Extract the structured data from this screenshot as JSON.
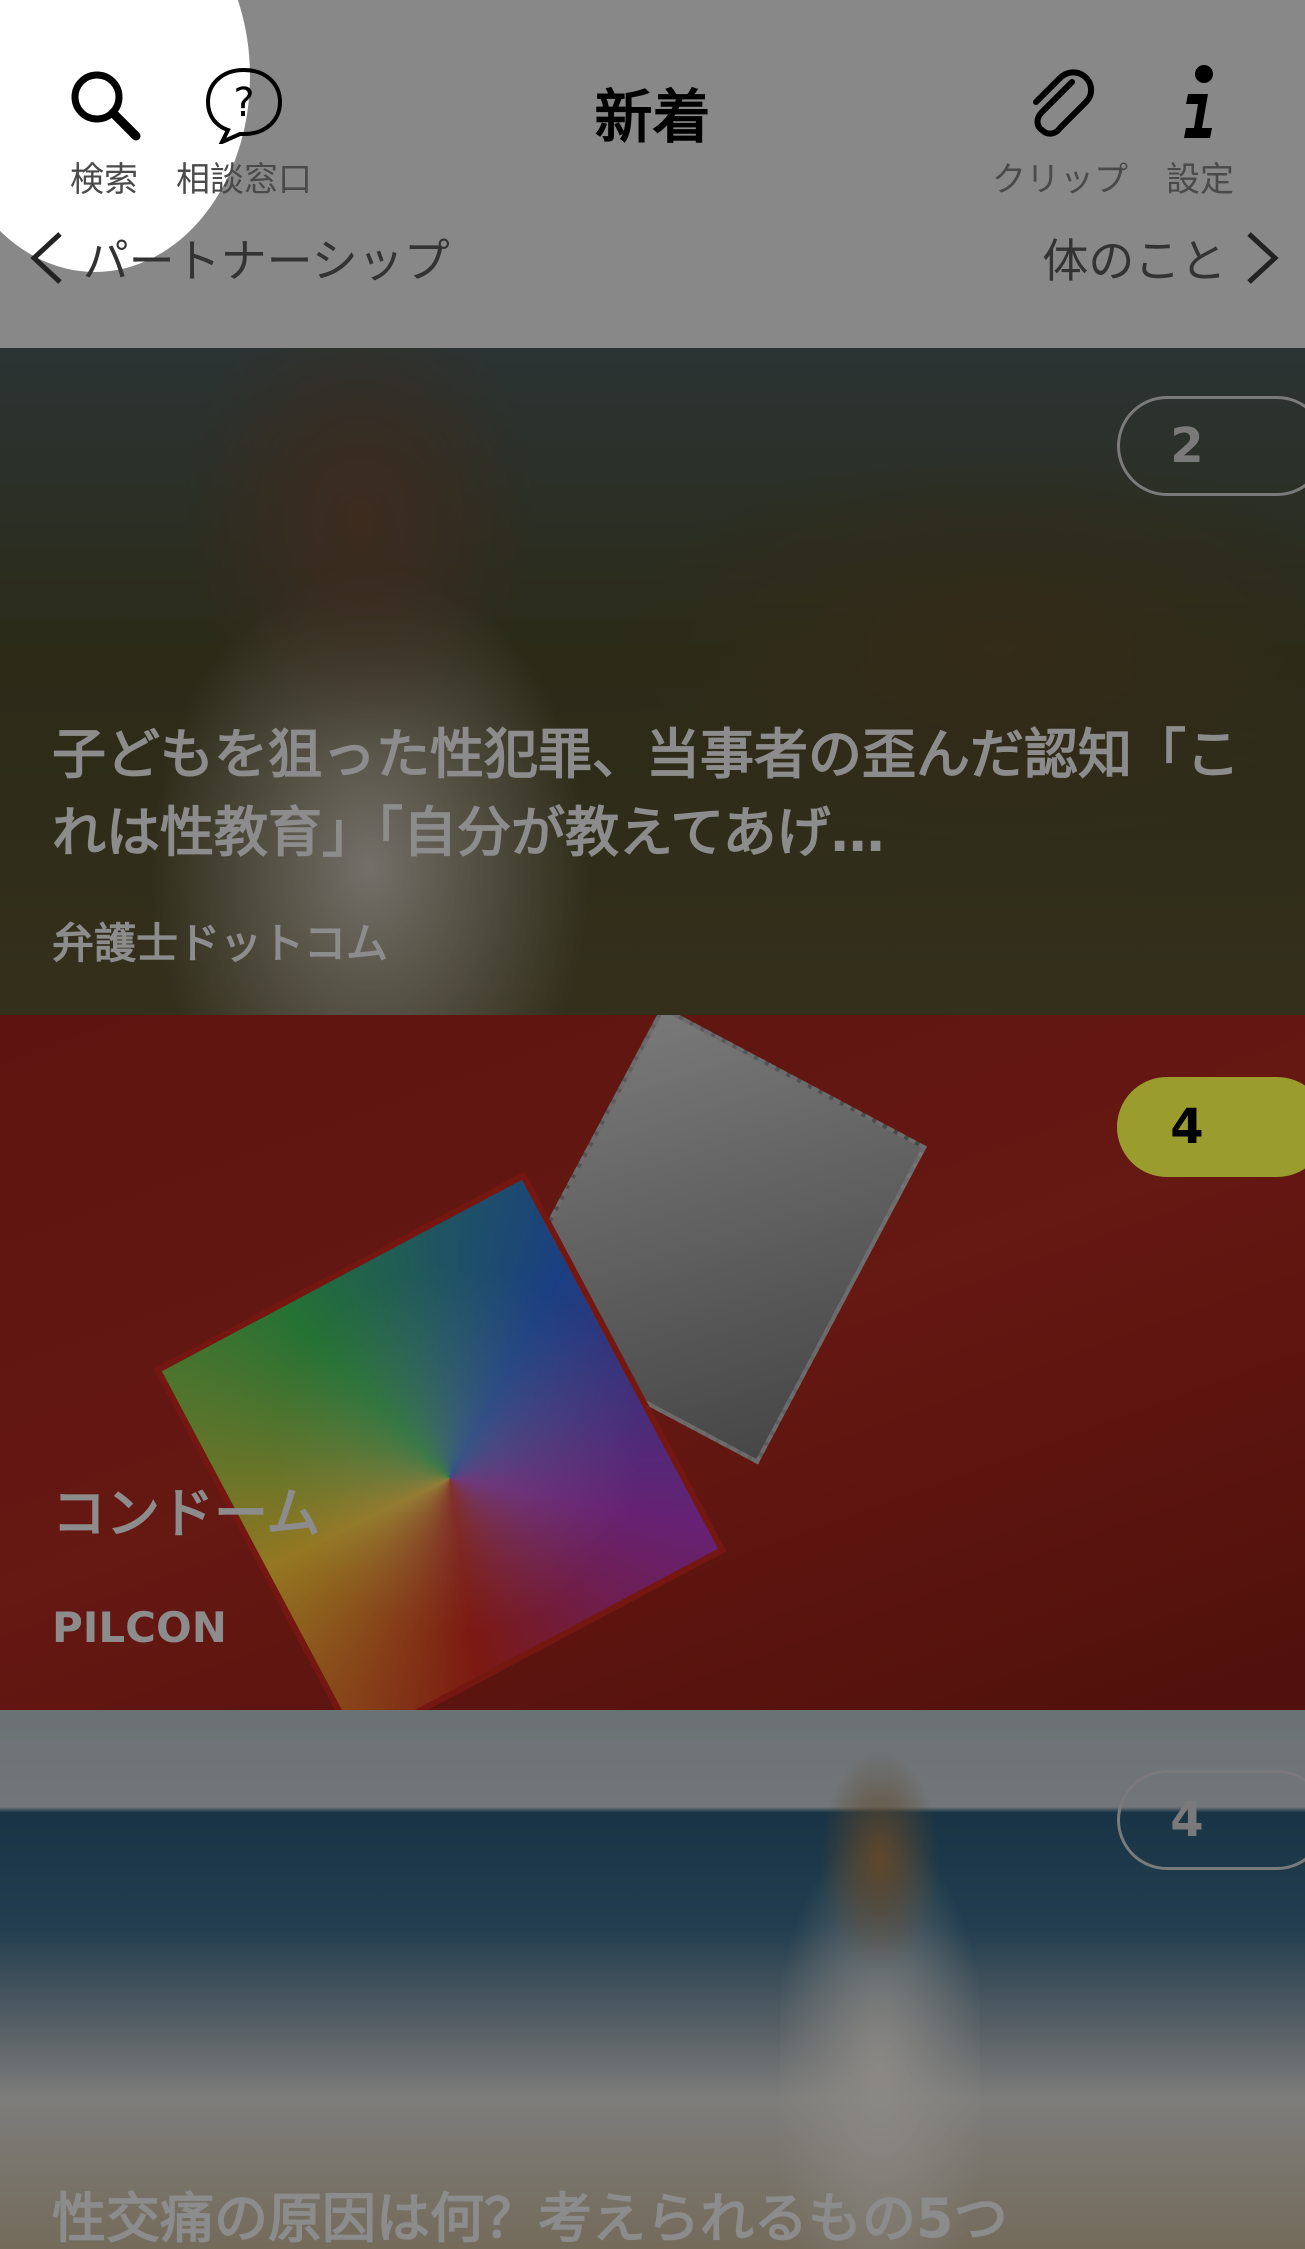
{
  "header": {
    "title": "新着",
    "search_label": "検索",
    "consult_label": "相談窓口",
    "clip_label": "クリップ",
    "settings_label": "設定",
    "prev_category": "パートナーシップ",
    "next_category": "体のこと"
  },
  "articles": [
    {
      "headline": "子どもを狙った性犯罪、当事者の歪んだ認知「これは性教育」「自分が教えてあげ…",
      "source": "弁護士ドットコム",
      "badge": "2"
    },
    {
      "headline": "コンドーム",
      "source": "PILCON",
      "badge": "4"
    },
    {
      "headline": "性交痛の原因は何？考えられるもの5つ",
      "source": "",
      "badge": "4"
    }
  ],
  "colors": {
    "badge_active": "#9a9c2e",
    "overlay": "#777777"
  }
}
